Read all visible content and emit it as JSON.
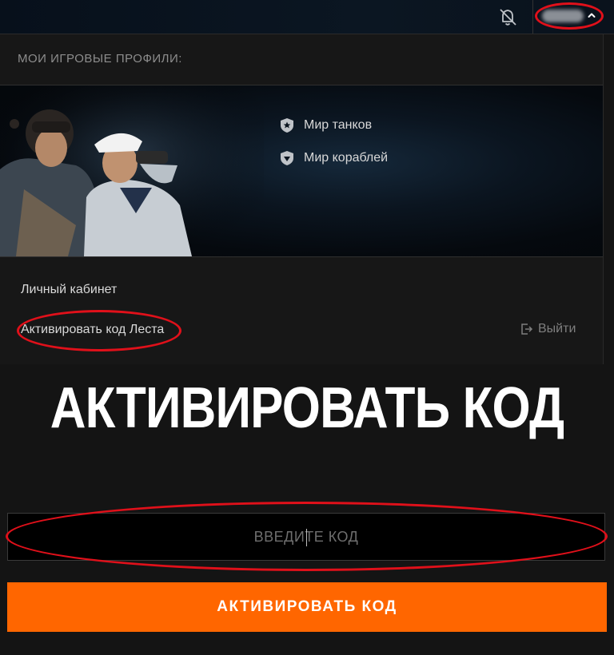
{
  "topbar": {
    "username": "••••••",
    "icons": {
      "notifications": "bell-off-icon",
      "expand": "chevron-up-icon"
    }
  },
  "panel": {
    "title": "МОИ ИГРОВЫЕ ПРОФИЛИ:",
    "games": [
      {
        "label": "Мир танков",
        "icon": "tank-shield-icon"
      },
      {
        "label": "Мир кораблей",
        "icon": "ship-anchor-icon"
      }
    ],
    "links": {
      "account": "Личный кабинет",
      "activate_code": "Активировать код Леста",
      "logout": "Выйти"
    }
  },
  "activation": {
    "heading": "АКТИВИРОВАТЬ КОД",
    "input_value": "",
    "input_placeholder": "ВВЕДИТЕ КОД",
    "button_label": "АКТИВИРОВАТЬ КОД"
  },
  "colors": {
    "accent": "#ff6600",
    "highlight_outline": "#e0101a",
    "background": "#141414"
  }
}
